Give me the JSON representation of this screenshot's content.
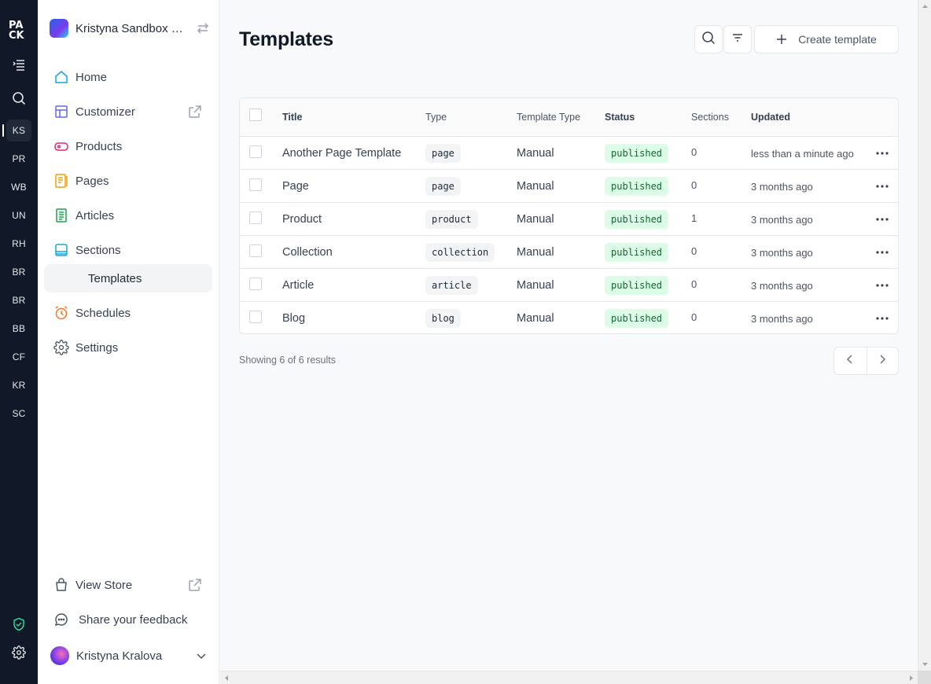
{
  "rail": {
    "stores": [
      "KS",
      "PR",
      "WB",
      "UN",
      "RH",
      "BR",
      "BR",
      "BB",
      "CF",
      "KR",
      "SC"
    ],
    "active_store": "KS"
  },
  "sidebar": {
    "org_name": "Kristyna Sandbox S...",
    "items": [
      {
        "label": "Home",
        "icon": "home-icon"
      },
      {
        "label": "Customizer",
        "icon": "layout-icon"
      },
      {
        "label": "Products",
        "icon": "tag-icon"
      },
      {
        "label": "Pages",
        "icon": "document-icon"
      },
      {
        "label": "Articles",
        "icon": "article-icon"
      },
      {
        "label": "Sections",
        "icon": "stack-icon"
      },
      {
        "label": "Templates",
        "icon": ""
      },
      {
        "label": "Schedules",
        "icon": "alarm-clock-icon"
      },
      {
        "label": "Settings",
        "icon": "gear-icon"
      }
    ],
    "view_store": "View Store",
    "feedback": "Share your feedback",
    "user_name": "Kristyna Kralova"
  },
  "main": {
    "title": "Templates",
    "create_label": "Create template",
    "columns": {
      "title": "Title",
      "type": "Type",
      "template_type": "Template Type",
      "status": "Status",
      "sections": "Sections",
      "updated": "Updated"
    },
    "rows": [
      {
        "title": "Another Page Template",
        "type": "page",
        "template_type": "Manual",
        "status": "published",
        "sections": "0",
        "updated": "less than a minute ago"
      },
      {
        "title": "Page",
        "type": "page",
        "template_type": "Manual",
        "status": "published",
        "sections": "0",
        "updated": "3 months ago"
      },
      {
        "title": "Product",
        "type": "product",
        "template_type": "Manual",
        "status": "published",
        "sections": "1",
        "updated": "3 months ago"
      },
      {
        "title": "Collection",
        "type": "collection",
        "template_type": "Manual",
        "status": "published",
        "sections": "0",
        "updated": "3 months ago"
      },
      {
        "title": "Article",
        "type": "article",
        "template_type": "Manual",
        "status": "published",
        "sections": "0",
        "updated": "3 months ago"
      },
      {
        "title": "Blog",
        "type": "blog",
        "template_type": "Manual",
        "status": "published",
        "sections": "0",
        "updated": "3 months ago"
      }
    ],
    "results_text": "Showing 6 of 6 results"
  },
  "colors": {
    "rail_bg": "#111827",
    "status_bg": "#dcfce7",
    "status_text": "#166534"
  }
}
